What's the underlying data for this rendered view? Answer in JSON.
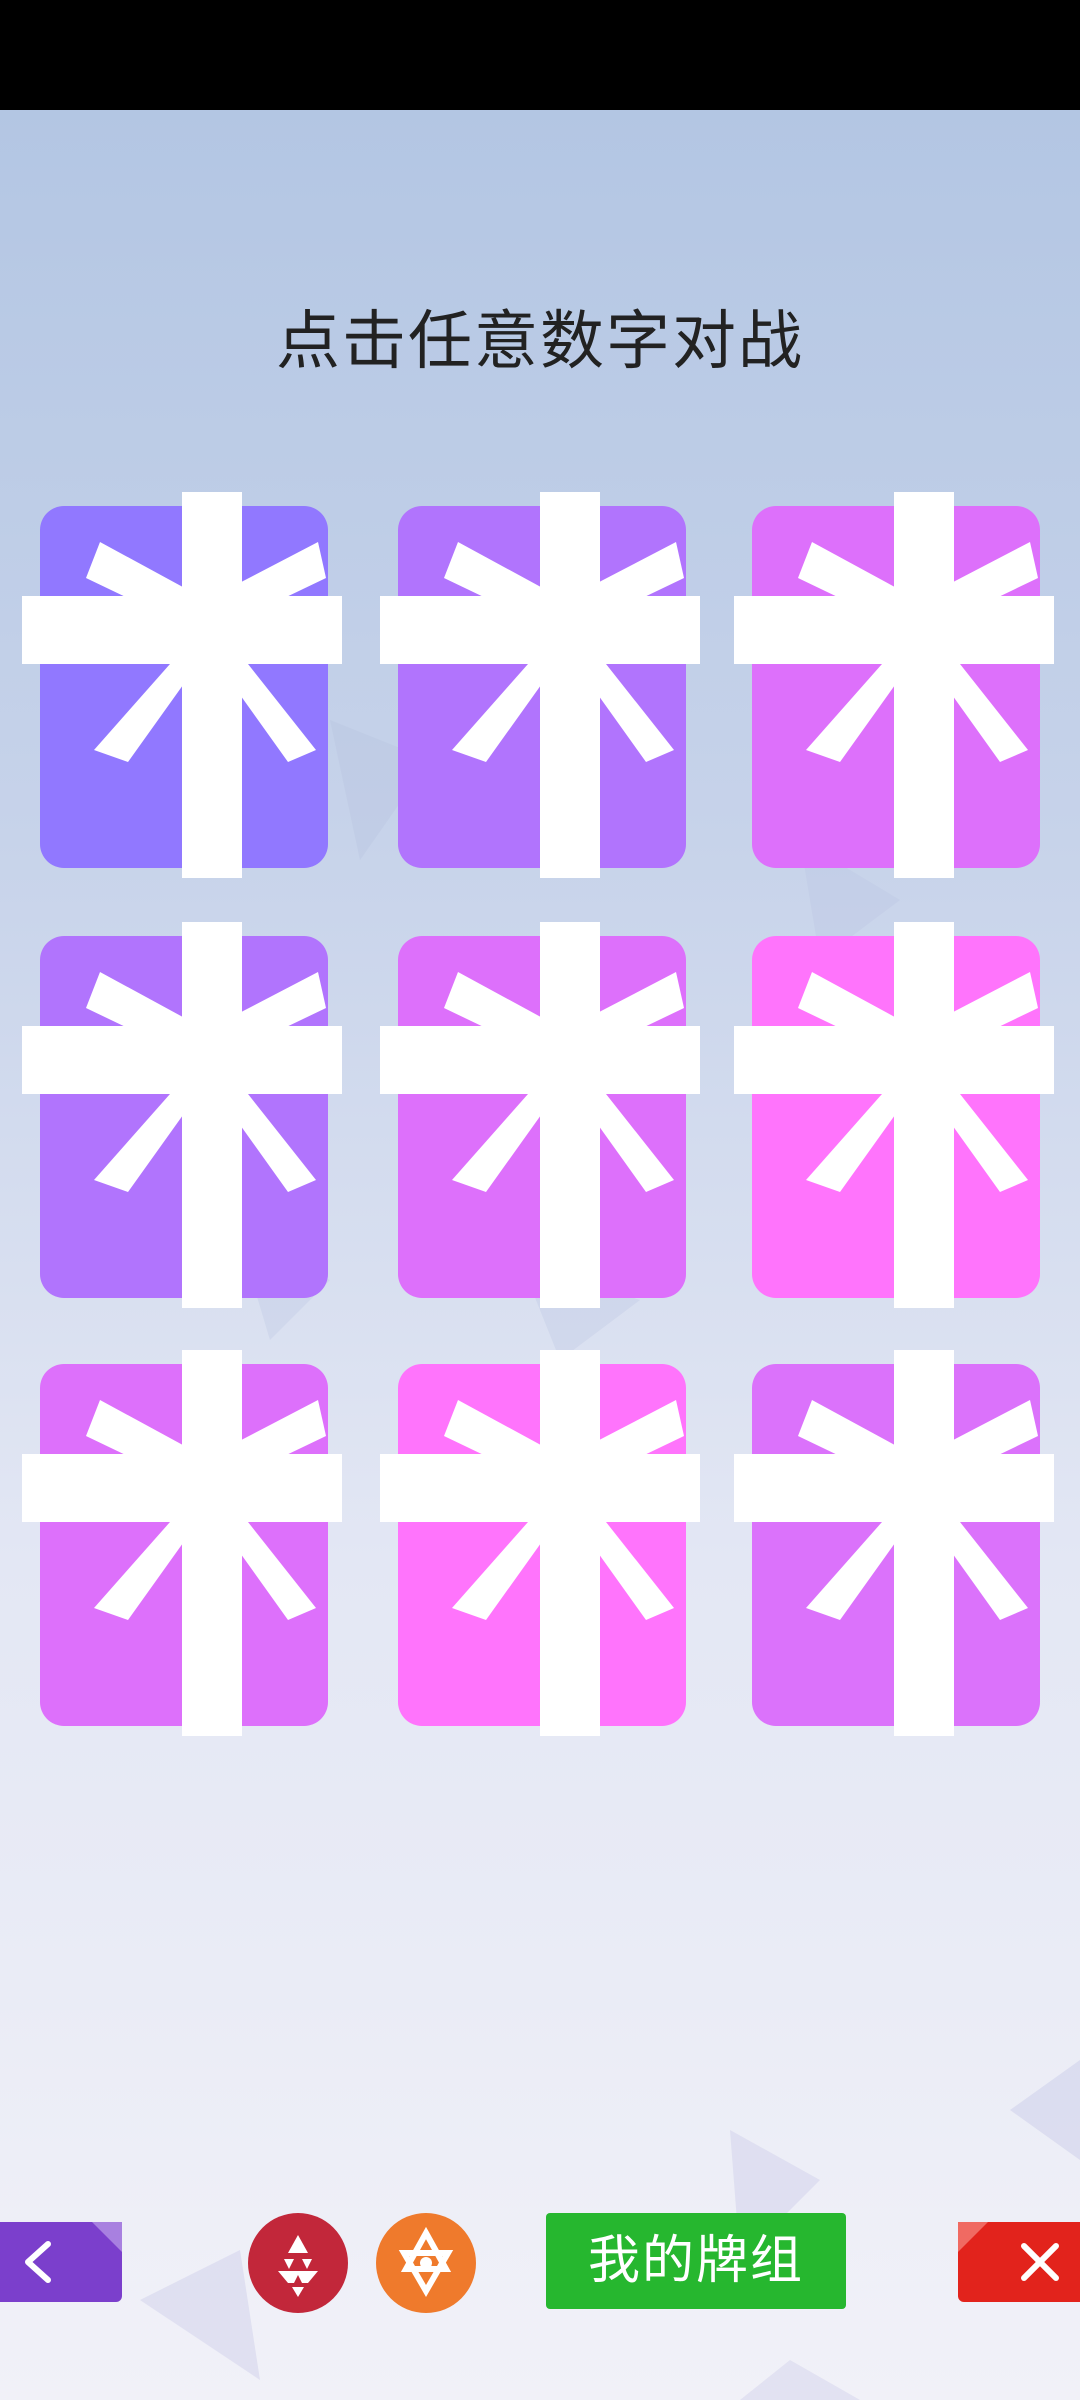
{
  "title": "点击任意数字对战",
  "gifts": [
    {
      "color": "#9178ff"
    },
    {
      "color": "#b174fd"
    },
    {
      "color": "#dd70fb"
    },
    {
      "color": "#b174fd"
    },
    {
      "color": "#dd70fb"
    },
    {
      "color": "#ff74fc"
    },
    {
      "color": "#dd70fb"
    },
    {
      "color": "#ff74fc"
    },
    {
      "color": "#db72fb"
    }
  ],
  "bottom_bar": {
    "back_icon": "chevron-left-icon",
    "red_emblem_icon": "triangle-emblem-icon",
    "orange_emblem_icon": "star-emblem-icon",
    "my_deck_label": "我的牌组",
    "close_icon": "close-icon",
    "colors": {
      "back": "#7b3fcc",
      "red_emblem": "#c2273a",
      "orange_emblem": "#ef7a2c",
      "my_deck": "#26b72f",
      "close": "#e2231c"
    }
  }
}
